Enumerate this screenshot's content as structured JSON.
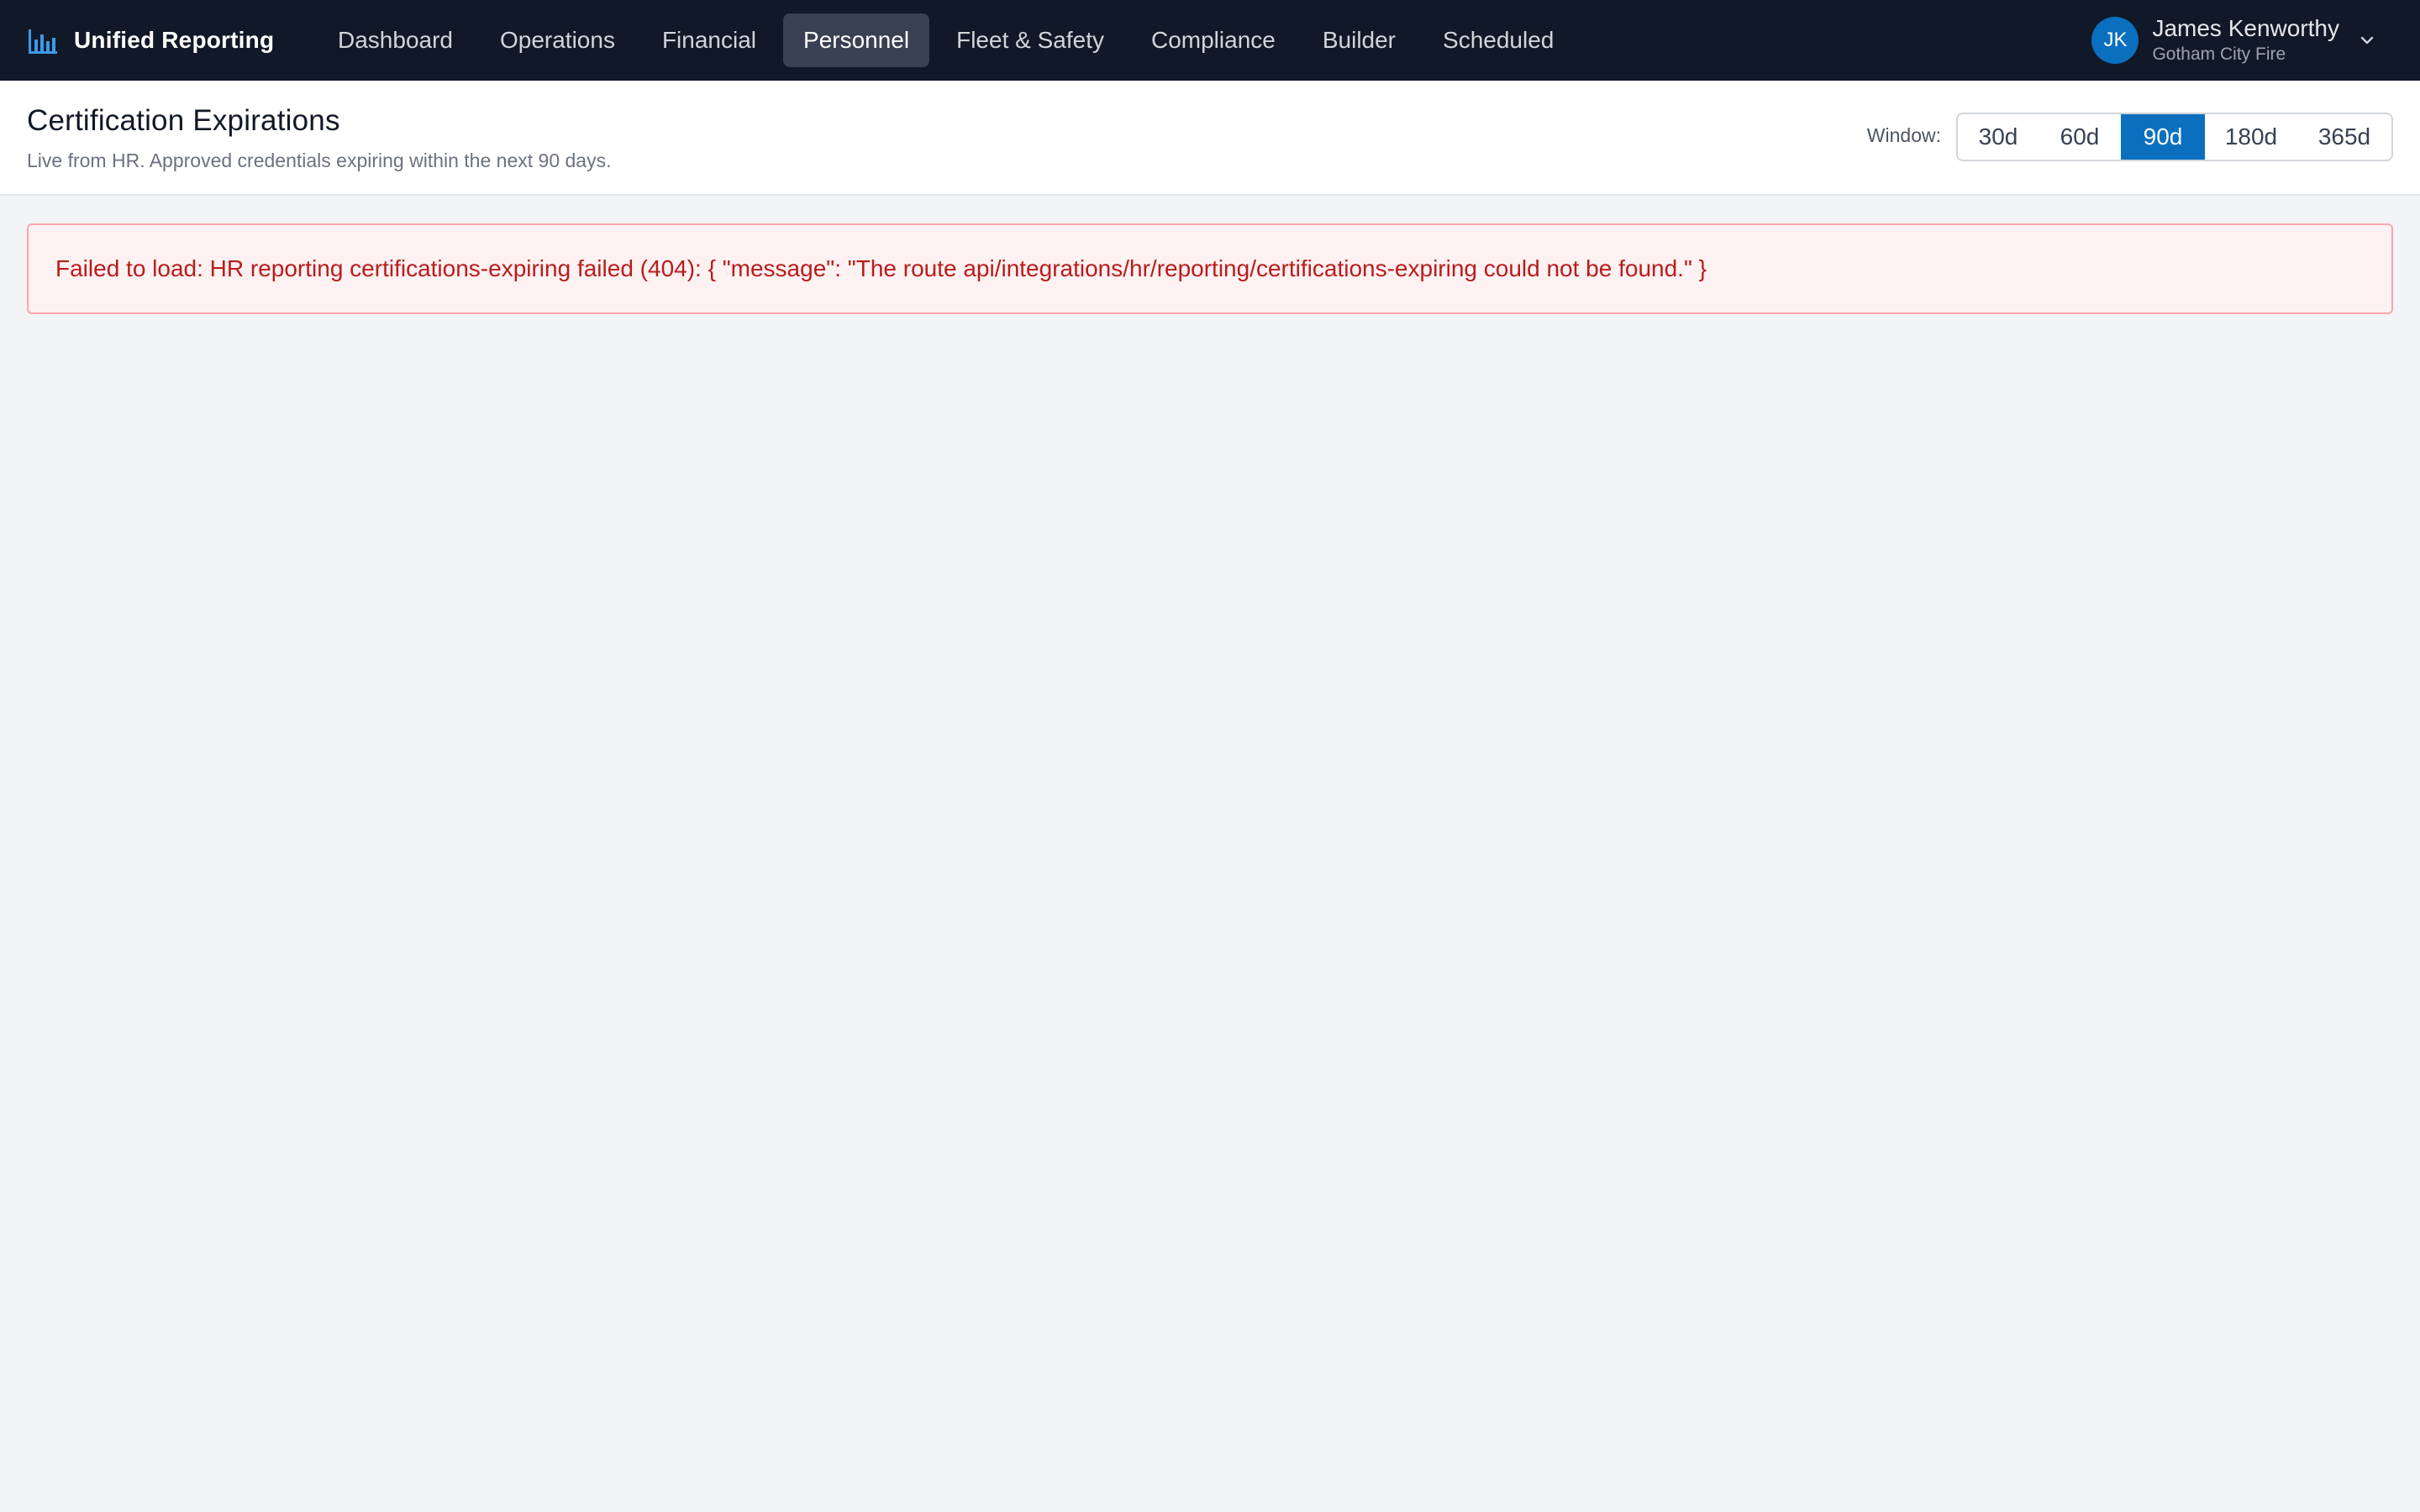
{
  "app": {
    "name": "Unified Reporting",
    "icon": "bar-chart-icon",
    "accent_color": "#0b6fbf"
  },
  "nav": {
    "items": [
      {
        "label": "Dashboard",
        "active": false
      },
      {
        "label": "Operations",
        "active": false
      },
      {
        "label": "Financial",
        "active": false
      },
      {
        "label": "Personnel",
        "active": true
      },
      {
        "label": "Fleet & Safety",
        "active": false
      },
      {
        "label": "Compliance",
        "active": false
      },
      {
        "label": "Builder",
        "active": false
      },
      {
        "label": "Scheduled",
        "active": false
      }
    ]
  },
  "user": {
    "initials": "JK",
    "name": "James Kenworthy",
    "org": "Gotham City Fire",
    "menu_icon": "chevron-down-icon"
  },
  "page": {
    "title": "Certification Expirations",
    "subtitle": "Live from HR. Approved credentials expiring within the next 90 days."
  },
  "window": {
    "label": "Window:",
    "options": [
      "30d",
      "60d",
      "90d",
      "180d",
      "365d"
    ],
    "selected": "90d"
  },
  "error": {
    "message": "Failed to load: HR reporting certifications-expiring failed (404): { \"message\": \"The route api/integrations/hr/reporting/certifications-expiring could not be found.\" }",
    "color": "#b91c1c"
  }
}
